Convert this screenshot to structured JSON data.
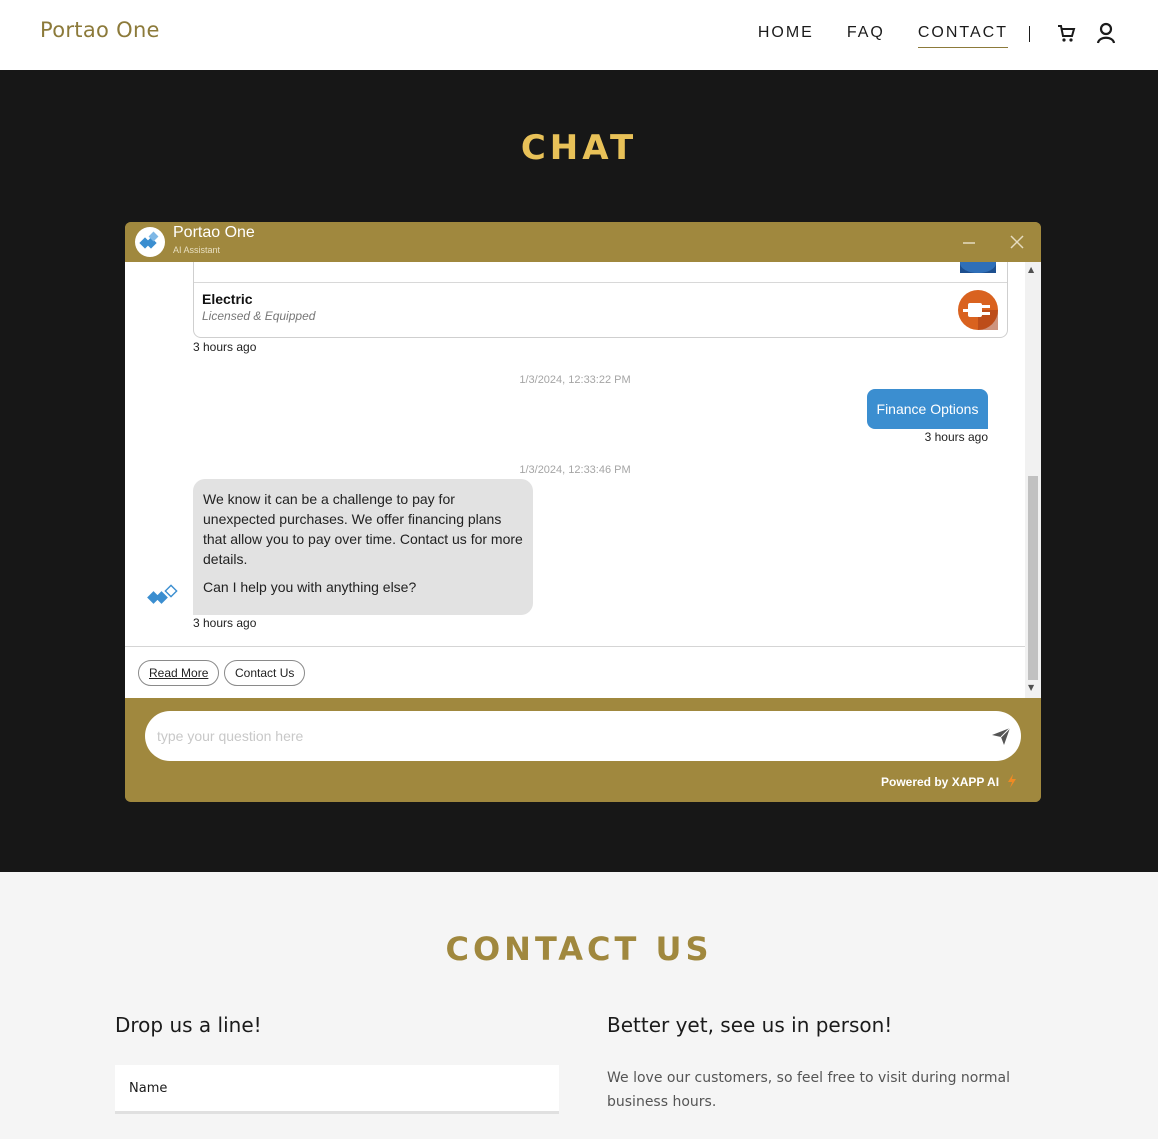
{
  "header": {
    "brand": "Portao One",
    "nav": [
      {
        "label": "HOME"
      },
      {
        "label": "FAQ"
      },
      {
        "label": "CONTACT",
        "active": true
      }
    ],
    "icons": [
      "cart-icon",
      "user-icon"
    ]
  },
  "chat_section": {
    "title": "CHAT"
  },
  "widget": {
    "name": "Portao One",
    "subtitle": "AI Assistant",
    "card": {
      "title": "Electric",
      "subtitle": "Licensed & Equipped",
      "time": "3 hours ago"
    },
    "messages": [
      {
        "timestamp": "1/3/2024, 12:33:22 PM",
        "from": "user",
        "text": "Finance Options",
        "time": "3 hours ago"
      },
      {
        "timestamp": "1/3/2024, 12:33:46 PM",
        "from": "bot",
        "paragraphs": [
          "We know it can be a challenge to pay for unexpected purchases. We offer financing plans that allow you to pay over time. Contact us for more details.",
          "Can I help you with anything else?"
        ],
        "time": "3 hours ago"
      }
    ],
    "quick_replies": [
      "Read More",
      "Contact Us"
    ],
    "input_placeholder": "type your question here",
    "powered_by": "Powered by XAPP AI"
  },
  "contact_section": {
    "title": "CONTACT US",
    "left_heading": "Drop us a line!",
    "name_placeholder": "Name",
    "right_heading": "Better yet, see us in person!",
    "right_text": "We love our customers, so feel free to visit during normal business hours."
  },
  "colors": {
    "gold": "#a0883e",
    "chat_title": "#e8c158",
    "dark_bg": "#171717",
    "user_bubble": "#3b8ed0",
    "bot_bubble": "#e2e2e2"
  }
}
